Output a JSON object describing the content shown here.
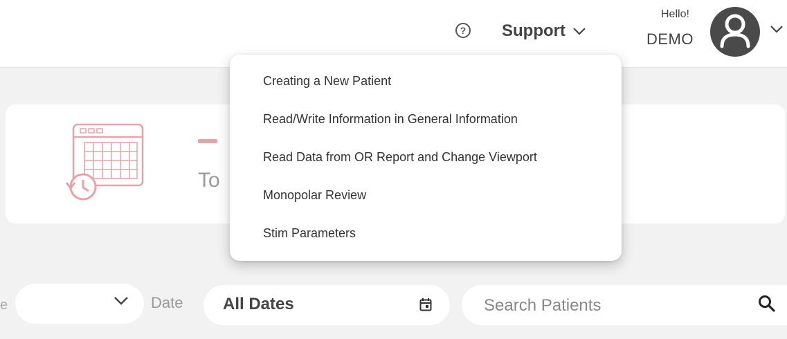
{
  "header": {
    "help_icon": "question-circle-icon",
    "help_glyph": "?",
    "support_label": "Support",
    "greeting": "Hello!",
    "user_name": "DEMO"
  },
  "support_menu": {
    "items": [
      {
        "label": "Creating a New Patient"
      },
      {
        "label": "Read/Write Information in General Information"
      },
      {
        "label": "Read Data from OR Report and Change Viewport"
      },
      {
        "label": "Monopolar Review"
      },
      {
        "label": "Stim Parameters"
      }
    ]
  },
  "patient_card": {
    "icon": "calendar-history-icon",
    "placeholder_dash": "–",
    "subtitle_fragment": "To"
  },
  "filters": {
    "left_fragment": "e",
    "date_label": "Date",
    "date_value": "All Dates",
    "search_placeholder": "Search Patients"
  },
  "colors": {
    "accent_pink": "#e6a3a8",
    "avatar_bg": "#4a4a4a",
    "page_bg": "#f2f2f2"
  }
}
